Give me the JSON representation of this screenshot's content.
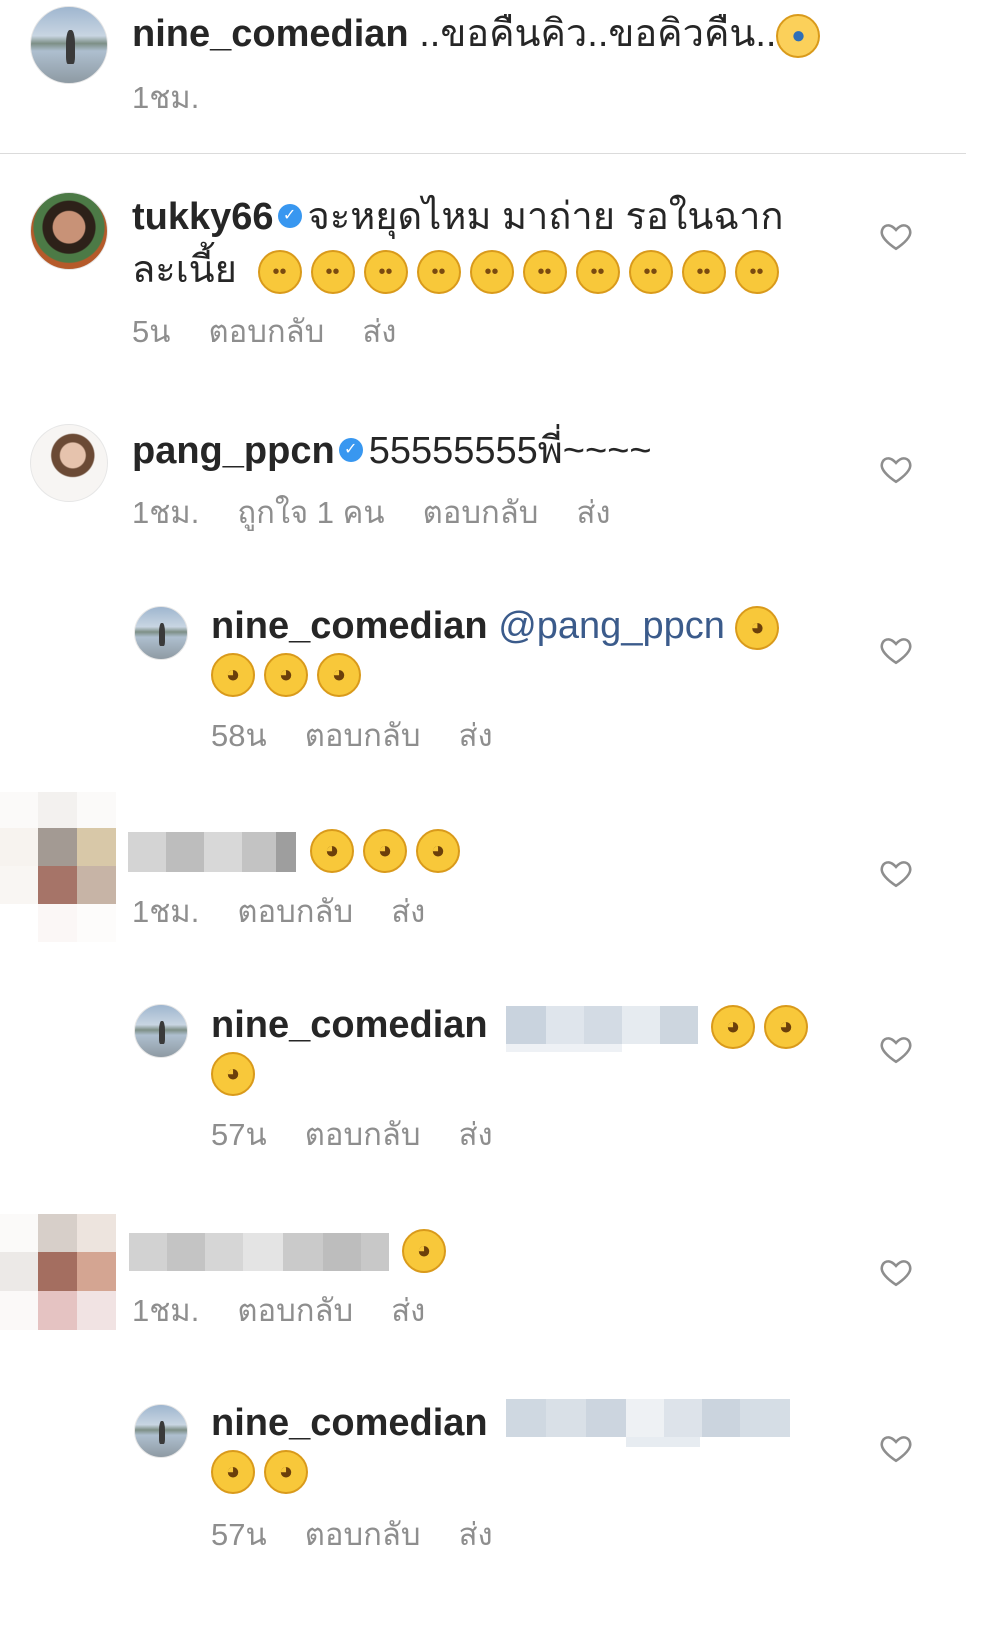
{
  "caption": {
    "username": "nine_comedian",
    "text": "..ขอคืนคิว..ขอคิวคืน..",
    "time": "1ชม."
  },
  "comments": [
    {
      "username": "tukky66",
      "verified": true,
      "text_line1": "จะหยุดไหม มาถ่าย รอในฉาก",
      "text_line2": "ละเนี้ย",
      "emoji": "rolling-eyes",
      "emoji_count": 10,
      "time": "5น",
      "reply": "ตอบกลับ",
      "send": "ส่ง"
    },
    {
      "username": "pang_ppcn",
      "verified": true,
      "text": "55555555พี่~~~~",
      "time": "1ชม.",
      "likes": "ถูกใจ 1 คน",
      "reply": "ตอบกลับ",
      "send": "ส่ง"
    },
    {
      "username": "nine_comedian",
      "mention": "@pang_ppcn",
      "emoji": "face-with-tears-of-joy",
      "time": "58น",
      "reply": "ตอบกลับ",
      "send": "ส่ง"
    },
    {
      "username_hidden": true,
      "emoji": "face-with-tears-of-joy",
      "time": "1ชม.",
      "reply": "ตอบกลับ",
      "send": "ส่ง"
    },
    {
      "username": "nine_comedian",
      "mention_hidden": true,
      "emoji": "face-with-tears-of-joy",
      "time": "57น",
      "reply": "ตอบกลับ",
      "send": "ส่ง"
    },
    {
      "username_hidden": true,
      "emoji": "face-with-tears-of-joy",
      "time": "1ชม.",
      "reply": "ตอบกลับ",
      "send": "ส่ง"
    },
    {
      "username": "nine_comedian",
      "mention_hidden": true,
      "emoji": "face-with-tears-of-joy",
      "time": "57น",
      "reply": "ตอบกลับ",
      "send": "ส่ง"
    }
  ],
  "colors": {
    "username": "#262626",
    "meta": "#8e8e8e",
    "mention": "#3b5b8b",
    "verified": "#3897f0",
    "divider": "#dbdbdb"
  },
  "icons": {
    "heart": "heart-outline-icon",
    "verified": "verified-badge-icon"
  }
}
